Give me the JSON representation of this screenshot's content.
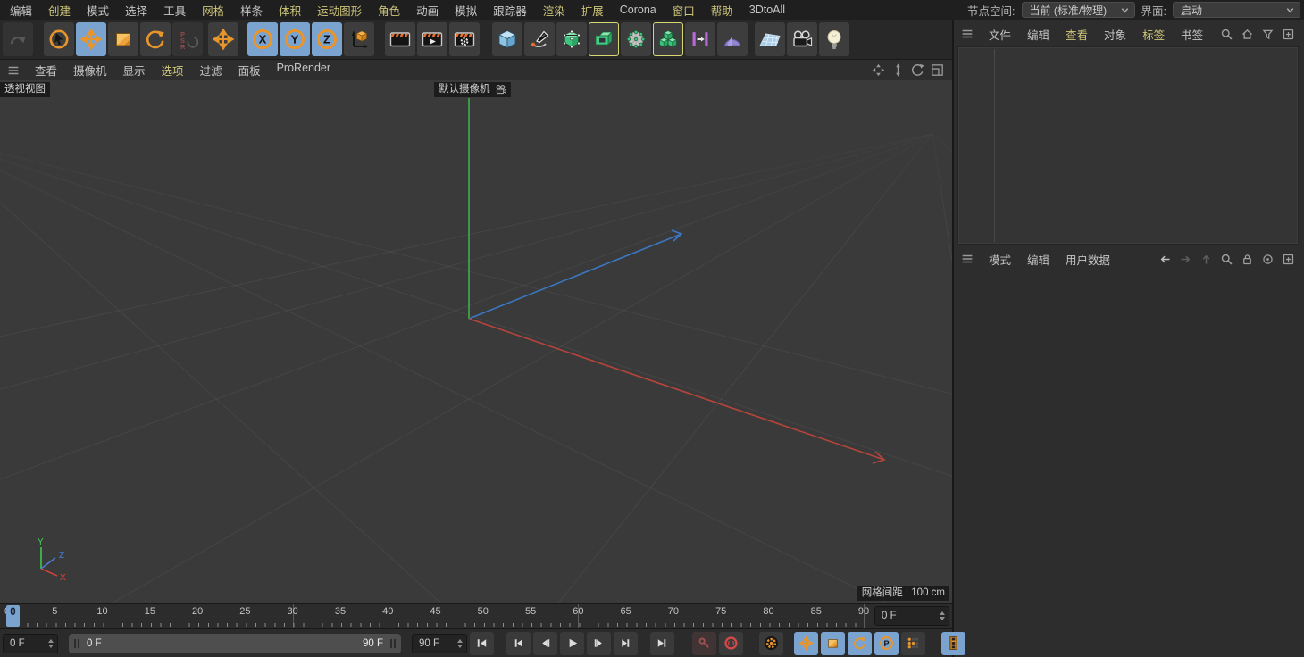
{
  "menubar": {
    "items": [
      {
        "id": "edit",
        "label": "编辑",
        "accent": false
      },
      {
        "id": "create",
        "label": "创建",
        "accent": true
      },
      {
        "id": "mode",
        "label": "模式",
        "accent": false
      },
      {
        "id": "select",
        "label": "选择",
        "accent": false
      },
      {
        "id": "tools",
        "label": "工具",
        "accent": false
      },
      {
        "id": "mesh",
        "label": "网格",
        "accent": true
      },
      {
        "id": "spline",
        "label": "样条",
        "accent": false
      },
      {
        "id": "volume",
        "label": "体积",
        "accent": true
      },
      {
        "id": "mograph",
        "label": "运动图形",
        "accent": true
      },
      {
        "id": "character",
        "label": "角色",
        "accent": true
      },
      {
        "id": "animate",
        "label": "动画",
        "accent": false
      },
      {
        "id": "simulate",
        "label": "模拟",
        "accent": false
      },
      {
        "id": "tracker",
        "label": "跟踪器",
        "accent": false
      },
      {
        "id": "render",
        "label": "渲染",
        "accent": true
      },
      {
        "id": "extensions",
        "label": "扩展",
        "accent": true
      },
      {
        "id": "corona",
        "label": "Corona",
        "accent": false
      },
      {
        "id": "window",
        "label": "窗口",
        "accent": true
      },
      {
        "id": "help",
        "label": "帮助",
        "accent": true
      },
      {
        "id": "3dtoall",
        "label": "3DtoAll",
        "accent": false
      }
    ],
    "node_space_label": "节点空间:",
    "node_space_value": "当前 (标准/物理)",
    "interface_label": "界面:",
    "interface_value": "启动"
  },
  "toolbar": {
    "buttons": [
      {
        "id": "undo-button",
        "icon": "undo-icon",
        "state": "dis"
      },
      {
        "gap": 10
      },
      {
        "id": "live-selection-tool",
        "icon": "live-selection-icon",
        "corner": true
      },
      {
        "id": "move-tool",
        "icon": "move-icon",
        "state": "sel",
        "corner": true
      },
      {
        "id": "scale-tool",
        "icon": "scale-icon",
        "corner": true
      },
      {
        "id": "rotate-tool",
        "icon": "rotate-icon",
        "corner": true
      },
      {
        "id": "last-tool-psr",
        "icon": "psr-icon",
        "state": "dis"
      },
      {
        "gap": 4
      },
      {
        "id": "axis-mode-toggle",
        "icon": "move-icon",
        "corner": true
      },
      {
        "gap": 8
      },
      {
        "id": "lock-x-axis-toggle",
        "icon": "axis-x-icon",
        "state": "sel"
      },
      {
        "id": "lock-y-axis-toggle",
        "icon": "axis-y-icon",
        "state": "sel"
      },
      {
        "id": "lock-z-axis-toggle",
        "icon": "axis-z-icon",
        "state": "sel"
      },
      {
        "id": "coordinate-system-toggle",
        "icon": "coord-cube-icon"
      },
      {
        "gap": 10
      },
      {
        "id": "render-view-button",
        "icon": "clapper-icon",
        "corner": true
      },
      {
        "id": "render-picture-viewer-button",
        "icon": "clapper-play-icon",
        "corner": true
      },
      {
        "id": "render-settings-button",
        "icon": "clapper-gear-icon",
        "corner": true
      },
      {
        "gap": 12
      },
      {
        "id": "add-cube-button",
        "icon": "cube-icon",
        "corner": true
      },
      {
        "id": "pen-spline-button",
        "icon": "pen-icon",
        "corner": true
      },
      {
        "id": "subdivision-surface-button",
        "icon": "subdiv-icon",
        "corner": true
      },
      {
        "id": "extrude-generator-button",
        "icon": "hollow-cube-icon",
        "corner": true,
        "highlight": true
      },
      {
        "id": "deformer-button",
        "icon": "sphere-dots-icon",
        "corner": true
      },
      {
        "id": "volume-builder-button",
        "icon": "volume-cubes-icon",
        "corner": true,
        "highlight": true
      },
      {
        "id": "mograph-cloner-button",
        "icon": "cloner-icon",
        "corner": true
      },
      {
        "id": "field-button",
        "icon": "field-icon",
        "corner": true
      },
      {
        "gap": 6
      },
      {
        "id": "floor-button",
        "icon": "floor-icon",
        "corner": true
      },
      {
        "id": "camera-button",
        "icon": "camera-icon",
        "corner": true
      },
      {
        "id": "light-button",
        "icon": "light-icon",
        "corner": true
      }
    ]
  },
  "viewport": {
    "menu": [
      {
        "id": "view",
        "label": "查看",
        "accent": false
      },
      {
        "id": "cameras",
        "label": "摄像机",
        "accent": false
      },
      {
        "id": "display",
        "label": "显示",
        "accent": false
      },
      {
        "id": "options",
        "label": "选项",
        "accent": true
      },
      {
        "id": "filter",
        "label": "过滤",
        "accent": false
      },
      {
        "id": "panel",
        "label": "面板",
        "accent": false
      },
      {
        "id": "prorender",
        "label": "ProRender",
        "accent": false
      }
    ],
    "nav_icons": [
      "pan-icon",
      "zoom-nav-icon",
      "rotate-nav-icon",
      "maximize-icon"
    ],
    "view_label": "透视视图",
    "camera_label": "默认摄像机",
    "grid_info": "网格间距 : 100 cm",
    "gizmo": {
      "x": "X",
      "y": "Y",
      "z": "Z"
    },
    "colors": {
      "background": "#3a3a3a",
      "x_axis": "#b5443c",
      "y_axis": "#3fae4c",
      "z_axis": "#3b77c2",
      "grid_line": "rgba(255,255,255,0.06)"
    }
  },
  "timeline": {
    "ruler_labels": [
      "0",
      "5",
      "10",
      "15",
      "20",
      "25",
      "30",
      "35",
      "40",
      "45",
      "50",
      "55",
      "60",
      "65",
      "70",
      "75",
      "80",
      "85",
      "90"
    ],
    "major_marks": [
      "30",
      "60",
      "90"
    ],
    "current_frame": "0",
    "current_frame_field": "0 F"
  },
  "transport": {
    "start_field": "0 F",
    "range_start_label": "0 F",
    "range_end_label": "90 F",
    "end_field": "90 F",
    "buttons": [
      {
        "id": "jump-start-button",
        "icon": "skip-start-icon"
      },
      {
        "gap": 8
      },
      {
        "id": "goto-prev-key-button",
        "icon": "prev-key-icon"
      },
      {
        "id": "goto-prev-frame-button",
        "icon": "prev-frame-icon"
      },
      {
        "id": "play-forward-button",
        "icon": "play-icon"
      },
      {
        "id": "goto-next-frame-button",
        "icon": "next-frame-icon"
      },
      {
        "id": "goto-next-key-button",
        "icon": "next-key-icon"
      },
      {
        "gap": 8
      },
      {
        "id": "jump-end-button",
        "icon": "skip-end-icon"
      },
      {
        "gap": 14
      },
      {
        "id": "record-keyframe-button",
        "icon": "key-icon",
        "state": "dis"
      },
      {
        "id": "autokey-toggle",
        "icon": "autokey-icon"
      },
      {
        "gap": 12
      },
      {
        "id": "keyframe-selection-button",
        "icon": "keyframe-gear-icon"
      },
      {
        "gap": 6
      },
      {
        "id": "record-position-toggle",
        "icon": "move-mini-icon",
        "state": "on"
      },
      {
        "id": "record-scale-toggle",
        "icon": "scale-mini-icon",
        "state": "on"
      },
      {
        "id": "record-rotation-toggle",
        "icon": "rotate-mini-icon",
        "state": "on"
      },
      {
        "id": "record-parameter-toggle",
        "icon": "parameter-icon",
        "state": "on"
      },
      {
        "id": "record-pla-toggle",
        "icon": "pla-dots-icon"
      },
      {
        "gap": 12
      },
      {
        "id": "timeline-window-button",
        "icon": "film-strip-icon",
        "state": "on",
        "corner": true
      }
    ]
  },
  "object_manager": {
    "menu": [
      {
        "id": "file",
        "label": "文件",
        "accent": false
      },
      {
        "id": "edit",
        "label": "编辑",
        "accent": false
      },
      {
        "id": "view",
        "label": "查看",
        "accent": true
      },
      {
        "id": "objects",
        "label": "对象",
        "accent": false
      },
      {
        "id": "tags",
        "label": "标签",
        "accent": true
      },
      {
        "id": "bookmark",
        "label": "书签",
        "accent": false
      }
    ],
    "icons": [
      "search-icon",
      "home-icon",
      "filter-icon",
      "add-box-icon"
    ]
  },
  "attribute_manager": {
    "menu": [
      {
        "id": "mode",
        "label": "模式",
        "accent": false
      },
      {
        "id": "edit",
        "label": "编辑",
        "accent": false
      },
      {
        "id": "userdata",
        "label": "用户数据",
        "accent": false
      }
    ],
    "icons": [
      "arrow-left-icon",
      "arrow-right-icon",
      "arrow-up-icon",
      "search-icon",
      "lock-icon",
      "target-icon",
      "add-box-icon"
    ]
  },
  "colors": {
    "accent_yellow": "#cdc57a",
    "selection_blue": "#7ba3d0",
    "icon_orange": "#e8952c",
    "highlight_border": "#d8d870"
  }
}
